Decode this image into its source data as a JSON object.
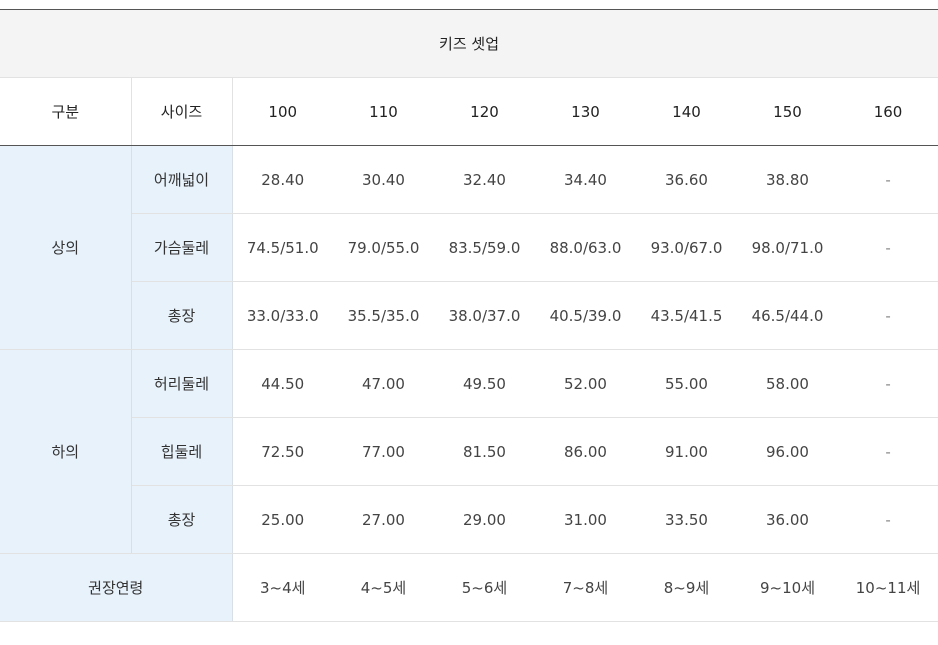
{
  "table_title": "키즈 셋업",
  "header": {
    "category": "구분",
    "size": "사이즈",
    "sizes": [
      "100",
      "110",
      "120",
      "130",
      "140",
      "150",
      "160"
    ]
  },
  "groups": [
    {
      "label": "상의",
      "rows": [
        {
          "label": "어깨넓이",
          "values": [
            "28.40",
            "30.40",
            "32.40",
            "34.40",
            "36.60",
            "38.80",
            "-"
          ]
        },
        {
          "label": "가슴둘레",
          "values": [
            "74.5/51.0",
            "79.0/55.0",
            "83.5/59.0",
            "88.0/63.0",
            "93.0/67.0",
            "98.0/71.0",
            "-"
          ]
        },
        {
          "label": "총장",
          "values": [
            "33.0/33.0",
            "35.5/35.0",
            "38.0/37.0",
            "40.5/39.0",
            "43.5/41.5",
            "46.5/44.0",
            "-"
          ]
        }
      ]
    },
    {
      "label": "하의",
      "rows": [
        {
          "label": "허리둘레",
          "values": [
            "44.50",
            "47.00",
            "49.50",
            "52.00",
            "55.00",
            "58.00",
            "-"
          ]
        },
        {
          "label": "힙둘레",
          "values": [
            "72.50",
            "77.00",
            "81.50",
            "86.00",
            "91.00",
            "96.00",
            "-"
          ]
        },
        {
          "label": "총장",
          "values": [
            "25.00",
            "27.00",
            "29.00",
            "31.00",
            "33.50",
            "36.00",
            "-"
          ]
        }
      ]
    }
  ],
  "age_row": {
    "label": "권장연령",
    "values": [
      "3~4세",
      "4~5세",
      "5~6세",
      "7~8세",
      "8~9세",
      "9~10세",
      "10~11세"
    ]
  }
}
